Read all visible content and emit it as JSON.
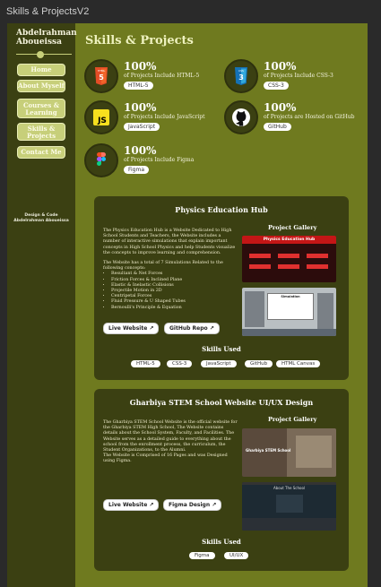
{
  "window": {
    "title": "Skills & ProjectsV2"
  },
  "sidebar": {
    "name_line1": "Abdelrahman",
    "name_line2": "Aboueissa",
    "nav": [
      {
        "label": "Home"
      },
      {
        "label": "About Myself"
      },
      {
        "label": "Courses & Learning"
      },
      {
        "label": "Skills & Projects"
      },
      {
        "label": "Contact Me"
      }
    ],
    "credit_line1": "Design & Code",
    "credit_line2": "Abdelrahman Aboueissa"
  },
  "main": {
    "title": "Skills & Projects",
    "skills": [
      {
        "icon": "html5-icon",
        "pct": "100%",
        "desc": "of Projects Include HTML-5",
        "tag": "HTML-5"
      },
      {
        "icon": "css3-icon",
        "pct": "100%",
        "desc": "of Projects Include CSS-3",
        "tag": "CSS-3"
      },
      {
        "icon": "javascript-icon",
        "pct": "100%",
        "desc": "of Projects Include JavaScript",
        "tag": "JavaScript"
      },
      {
        "icon": "github-icon",
        "pct": "100%",
        "desc": "of Projects are Hosted on GitHub",
        "tag": "GitHub"
      },
      {
        "icon": "figma-icon",
        "pct": "100%",
        "desc": "of Projects Include Figma",
        "tag": "Figma"
      }
    ]
  },
  "projects": [
    {
      "title": "Physics Education Hub",
      "gallery_title": "Project Gallery",
      "para1": "The Physics Education Hub is a Website Dedicated to High School Students and Teachers, the Website includes a number of interactive simulations that explain important concepts in High School Physics and help Students visualize the concepts to improve learning and comprehension.",
      "para2": "The Website has a total of 7 Simulations Related to the following concepts:",
      "list": [
        "Resultant & Net Forces",
        "Friction Forces & Inclined Plane",
        "Elastic & Inelastic Collisions",
        "Projectile Motion in 2D",
        "Centripetal Forces",
        "Fluid Pressure & U Shaped Tubes",
        "Bernoulli's Principle & Equation"
      ],
      "btn1": "Live Website",
      "btn2": "GitHub Repo",
      "skills_used_title": "Skills Used",
      "skills_used": [
        "HTML-5",
        "CSS-3",
        "JavaScript",
        "GitHub",
        "HTML Canvas"
      ],
      "shot1_header": "Physics Education Hub",
      "shot2_title": "Simulation"
    },
    {
      "title": "Gharbiya STEM School Website UI/UX Design",
      "gallery_title": "Project Gallery",
      "para1": "The Gharbiya STEM School Website is the official website for the Gharbiya STEM High School, The Website contains details about the School System, Faculty, and Facilities. The Website serves as a detailed guide to everything about the school from the enrollment process, the curriculum, the Student Organizations, to the Alumni.",
      "para2": "The Website is Comprised of 16 Pages and was Designed using Figma.",
      "btn1": "Live Website",
      "btn2": "Figma Design",
      "skills_used_title": "Skills Used",
      "skills_used": [
        "Figma",
        "UI/UX"
      ],
      "shot1_header": "Gharbiya STEM School",
      "shot2_title": "About The School"
    }
  ],
  "colors": {
    "background": "#6f7a1f",
    "sidebar": "#3b4012",
    "accent": "#c7cf7a"
  }
}
